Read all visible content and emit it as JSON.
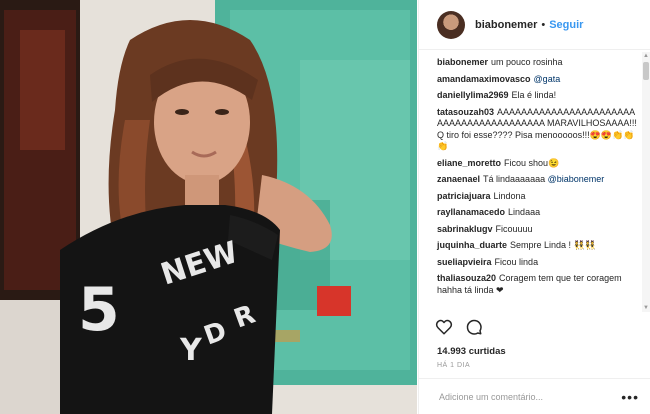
{
  "post": {
    "username": "biabonemer",
    "separator": "•",
    "follow_label": "Seguir",
    "likes": "14.993 curtidas",
    "time": "HÁ 1 DIA",
    "comment_placeholder": "Adicione um comentário...",
    "more_icon": "•••",
    "shirt_text": [
      "5",
      "NEW",
      "Y",
      "D",
      "R"
    ]
  },
  "comments": [
    {
      "user": "biabonemer",
      "text": "um pouco rosinha"
    },
    {
      "user": "amandamaximovasco",
      "text": "",
      "mention": "@gata"
    },
    {
      "user": "daniellylima2969",
      "text": "Ela é linda!"
    },
    {
      "user": "tatasouzah03",
      "text": "AAAAAAAAAAAAAAAAAAAAAAAAAAAAAAAAAAAAAAAAA MARAVILHOSAAAA!!! Q tiro foi esse???? Pisa menooooos!!!😍😍👏👏👏"
    },
    {
      "user": "eliane_moretto",
      "text": "Ficou shou😉"
    },
    {
      "user": "zanaenael",
      "text": "Tá lindaaaaaaa",
      "mention": "@biabonemer"
    },
    {
      "user": "patriciajuara",
      "text": "Lindona"
    },
    {
      "user": "rayllanamacedo",
      "text": "Lindaaa"
    },
    {
      "user": "sabrinaklugv",
      "text": "Ficouuuu"
    },
    {
      "user": "juquinha_duarte",
      "text": "Sempre Linda ! 👯👯"
    },
    {
      "user": "sueliapvieira",
      "text": "Ficou linda"
    },
    {
      "user": "thaliasouza20",
      "text": "Coragem tem que ter coragem hahha tá linda ❤"
    }
  ],
  "icons": {
    "like": "heart-icon",
    "comment": "comment-icon",
    "more": "more-options-icon"
  },
  "colors": {
    "accent": "#3897f0",
    "text": "#262626",
    "muted": "#999999"
  }
}
